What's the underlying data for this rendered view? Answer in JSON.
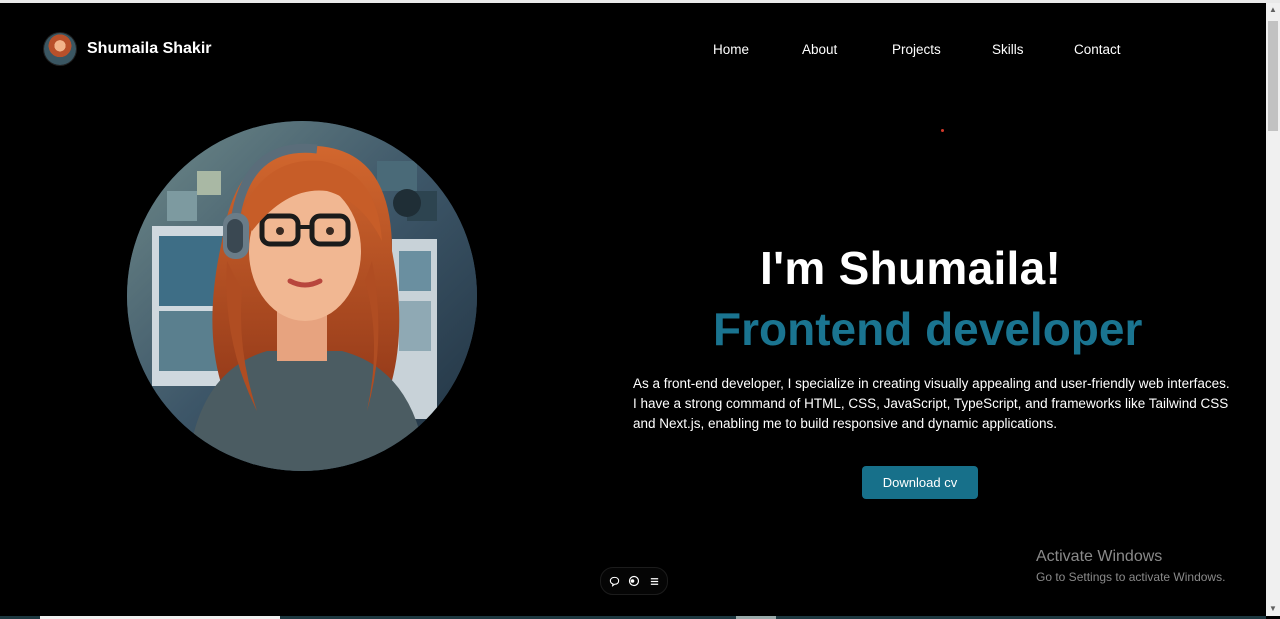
{
  "brand": {
    "name": "Shumaila Shakir",
    "avatar_icon": "profile-avatar"
  },
  "nav": {
    "links": [
      {
        "label": "Home"
      },
      {
        "label": "About"
      },
      {
        "label": "Projects"
      },
      {
        "label": "Skills"
      },
      {
        "label": "Contact"
      }
    ]
  },
  "hero": {
    "title": "I'm Shumaila!",
    "role": "Frontend developer",
    "description": "As a front-end developer, I specialize in creating visually appealing and user-friendly web interfaces. I have a strong command of HTML, CSS, JavaScript, TypeScript, and frameworks like Tailwind CSS and Next.js, enabling me to build responsive and dynamic applications.",
    "cta_label": "Download cv",
    "portrait_icon": "developer-illustration"
  },
  "floating_toolbar": {
    "icons": [
      "chat-bubble-icon",
      "toggle-icon",
      "menu-icon"
    ]
  },
  "watermark": {
    "title": "Activate Windows",
    "subtitle": "Go to Settings to activate Windows."
  },
  "colors": {
    "background": "#000000",
    "accent": "#1a7490",
    "button": "#17708a",
    "text": "#ffffff"
  }
}
